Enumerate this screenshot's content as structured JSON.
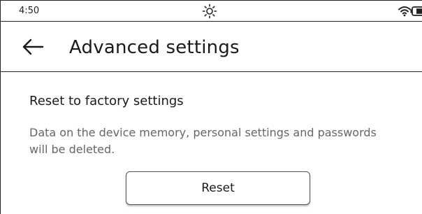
{
  "status_bar": {
    "time": "4:50",
    "icons": [
      "brightness-icon",
      "wifi-icon",
      "battery-icon"
    ]
  },
  "header": {
    "back_icon": "arrow-left-icon",
    "title": "Advanced settings"
  },
  "reset_section": {
    "title": "Reset to factory settings",
    "description": "Data on the device memory, personal settings and passwords will be deleted.",
    "button_label": "Reset"
  }
}
